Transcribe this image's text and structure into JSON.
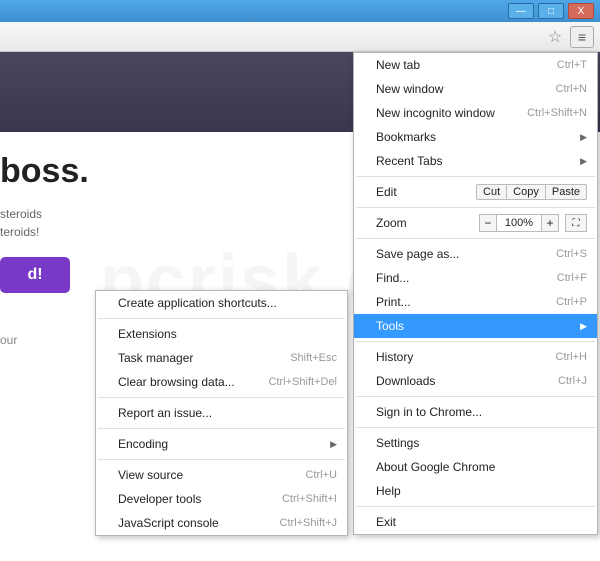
{
  "window": {
    "minimize": "—",
    "maximize": "□",
    "close": "X"
  },
  "page": {
    "hero_title": "boss.",
    "sub1": "steroids",
    "sub2": "teroids!",
    "cta": "d!",
    "footer": "our"
  },
  "main_menu": [
    {
      "type": "item",
      "label": "New tab",
      "shortcut": "Ctrl+T"
    },
    {
      "type": "item",
      "label": "New window",
      "shortcut": "Ctrl+N"
    },
    {
      "type": "item",
      "label": "New incognito window",
      "shortcut": "Ctrl+Shift+N"
    },
    {
      "type": "sub",
      "label": "Bookmarks"
    },
    {
      "type": "sub",
      "label": "Recent Tabs"
    },
    {
      "type": "sep"
    },
    {
      "type": "edit",
      "label": "Edit",
      "buttons": [
        "Cut",
        "Copy",
        "Paste"
      ]
    },
    {
      "type": "sep"
    },
    {
      "type": "zoom",
      "label": "Zoom",
      "value": "100%"
    },
    {
      "type": "sep"
    },
    {
      "type": "item",
      "label": "Save page as...",
      "shortcut": "Ctrl+S"
    },
    {
      "type": "item",
      "label": "Find...",
      "shortcut": "Ctrl+F"
    },
    {
      "type": "item",
      "label": "Print...",
      "shortcut": "Ctrl+P"
    },
    {
      "type": "sub",
      "label": "Tools",
      "selected": true
    },
    {
      "type": "sep"
    },
    {
      "type": "item",
      "label": "History",
      "shortcut": "Ctrl+H"
    },
    {
      "type": "item",
      "label": "Downloads",
      "shortcut": "Ctrl+J"
    },
    {
      "type": "sep"
    },
    {
      "type": "item",
      "label": "Sign in to Chrome..."
    },
    {
      "type": "sep"
    },
    {
      "type": "item",
      "label": "Settings"
    },
    {
      "type": "item",
      "label": "About Google Chrome"
    },
    {
      "type": "item",
      "label": "Help"
    },
    {
      "type": "sep"
    },
    {
      "type": "item",
      "label": "Exit"
    }
  ],
  "sub_menu": [
    {
      "type": "item",
      "label": "Create application shortcuts..."
    },
    {
      "type": "sep"
    },
    {
      "type": "item",
      "label": "Extensions"
    },
    {
      "type": "item",
      "label": "Task manager",
      "shortcut": "Shift+Esc"
    },
    {
      "type": "item",
      "label": "Clear browsing data...",
      "shortcut": "Ctrl+Shift+Del"
    },
    {
      "type": "sep"
    },
    {
      "type": "item",
      "label": "Report an issue..."
    },
    {
      "type": "sep"
    },
    {
      "type": "sub",
      "label": "Encoding"
    },
    {
      "type": "sep"
    },
    {
      "type": "item",
      "label": "View source",
      "shortcut": "Ctrl+U"
    },
    {
      "type": "item",
      "label": "Developer tools",
      "shortcut": "Ctrl+Shift+I"
    },
    {
      "type": "item",
      "label": "JavaScript console",
      "shortcut": "Ctrl+Shift+J"
    }
  ],
  "watermark": "pcrisk.com"
}
